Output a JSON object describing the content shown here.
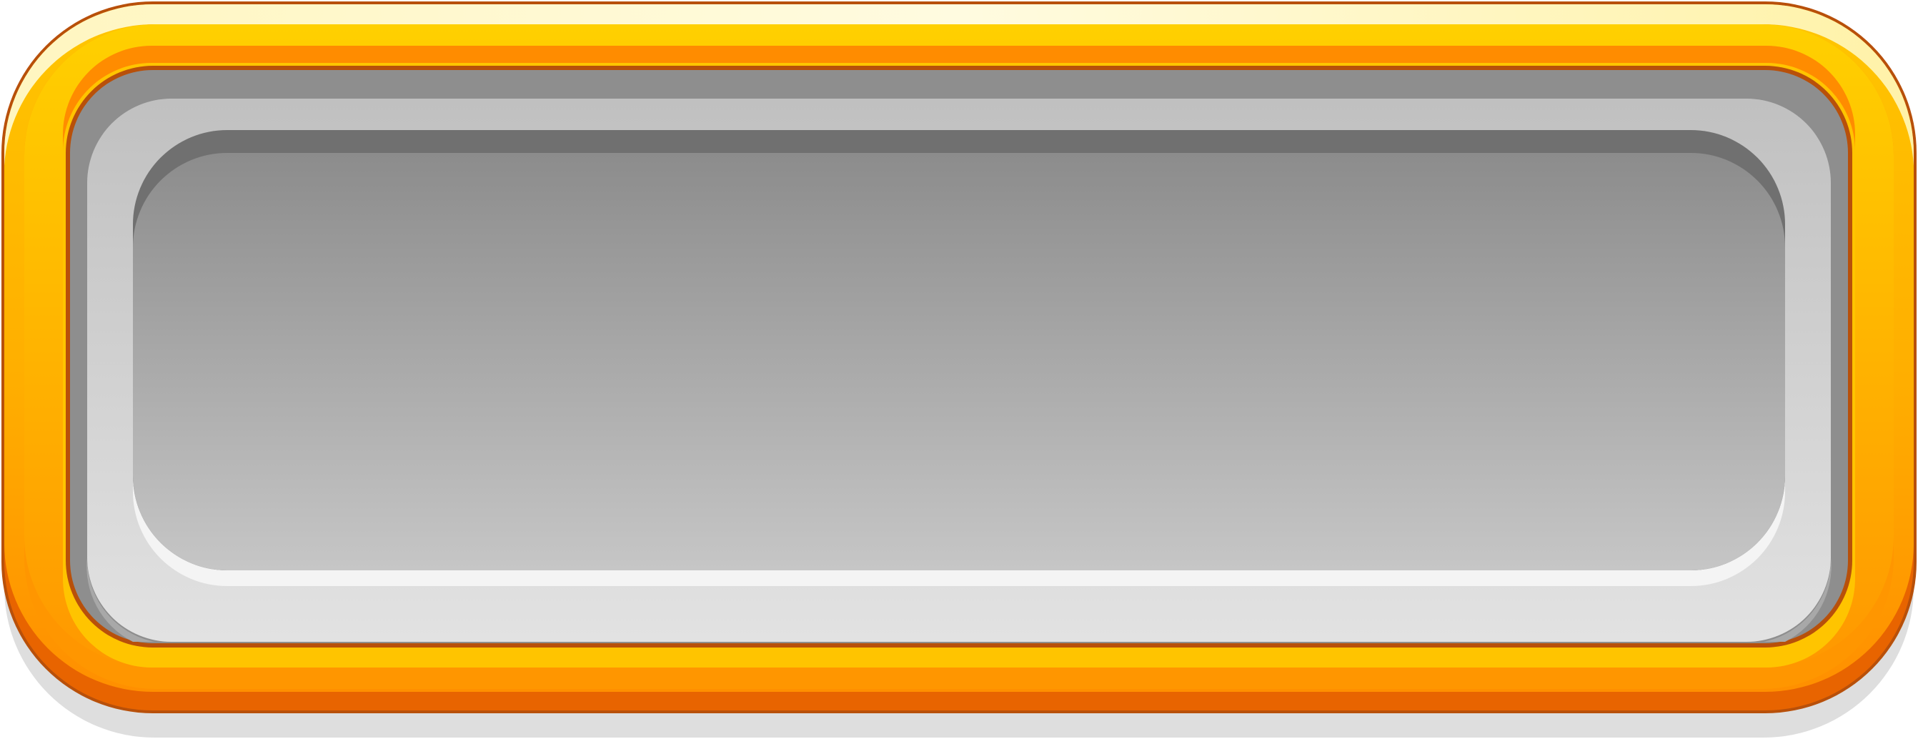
{
  "panel": {
    "kind": "game-ui-panel",
    "text": "",
    "colors": {
      "frame_outline": "#b8500a",
      "frame_dark": "#e86400",
      "frame_mid": "#ff9a00",
      "frame_light": "#ffc600",
      "frame_highlight": "#fff3b0",
      "bezel_light": "#e0e0e0",
      "bezel_dark": "#c2c2c2",
      "inset_dark": "#8e8e8e",
      "inset_light": "#c4c4c4",
      "inset_shadow": "#707070",
      "drop_shadow": "#dedede"
    }
  }
}
